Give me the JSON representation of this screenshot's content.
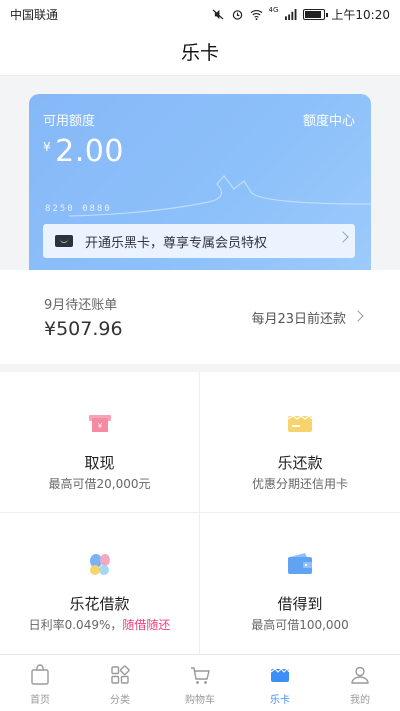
{
  "status_bar": {
    "carrier": "中国联通",
    "network": "4G",
    "time": "上午10:20"
  },
  "nav": {
    "title": "乐卡"
  },
  "card": {
    "label": "可用额度",
    "link": "额度中心",
    "currency": "¥",
    "amount": "2.00",
    "number": "8250 0880",
    "promo_text": "开通乐黑卡，尊享专属会员特权"
  },
  "bill": {
    "title": "9月待还账单",
    "amount": "¥507.96",
    "due_text": "每月23日前还款"
  },
  "services": [
    {
      "name": "取现",
      "desc": "最高可借20,000元",
      "icon": "cash-icon"
    },
    {
      "name": "乐还款",
      "desc": "优惠分期还信用卡",
      "icon": "repay-card-icon"
    },
    {
      "name": "乐花借款",
      "desc_plain": "日利率0.049%，",
      "desc_highlight": "随借随还",
      "icon": "flower-loan-icon"
    },
    {
      "name": "借得到",
      "desc": "最高可借100,000",
      "icon": "wallet-icon"
    }
  ],
  "tabs": [
    {
      "label": "首页",
      "icon": "home-bag-icon"
    },
    {
      "label": "分类",
      "icon": "category-icon"
    },
    {
      "label": "购物车",
      "icon": "cart-icon"
    },
    {
      "label": "乐卡",
      "icon": "lecard-icon"
    },
    {
      "label": "我的",
      "icon": "profile-icon"
    }
  ],
  "colors": {
    "accent": "#3e8ef7",
    "card": "#8cc0fa",
    "highlight": "#e8407e"
  }
}
